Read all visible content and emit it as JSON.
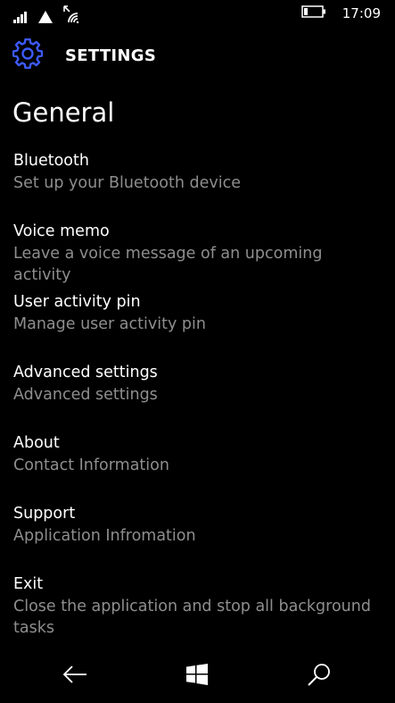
{
  "status_bar": {
    "time": "17:09",
    "icons": [
      "signal-icon",
      "data-triangle-icon",
      "wifi-icon",
      "battery-icon"
    ]
  },
  "header": {
    "icon": "gear-icon",
    "title": "SETTINGS",
    "accent_color": "#3d5afe"
  },
  "section": {
    "title": "General"
  },
  "menu": {
    "items": [
      {
        "label": "Bluetooth",
        "description": "Set up your Bluetooth device"
      },
      {
        "label": "Voice memo",
        "description": "Leave a voice message of an upcoming activity"
      },
      {
        "label": "User activity pin",
        "description": "Manage user activity pin"
      },
      {
        "label": "Advanced settings",
        "description": "Advanced settings"
      },
      {
        "label": "About",
        "description": "Contact Information"
      },
      {
        "label": "Support",
        "description": "Application Infromation"
      },
      {
        "label": "Exit",
        "description": "Close the application and stop all background tasks"
      }
    ]
  },
  "nav_bar": {
    "icons": [
      "back-arrow-icon",
      "windows-start-icon",
      "search-icon"
    ]
  },
  "colors": {
    "background": "#000000",
    "primary_text": "#ffffff",
    "secondary_text": "#8e8e8e"
  }
}
